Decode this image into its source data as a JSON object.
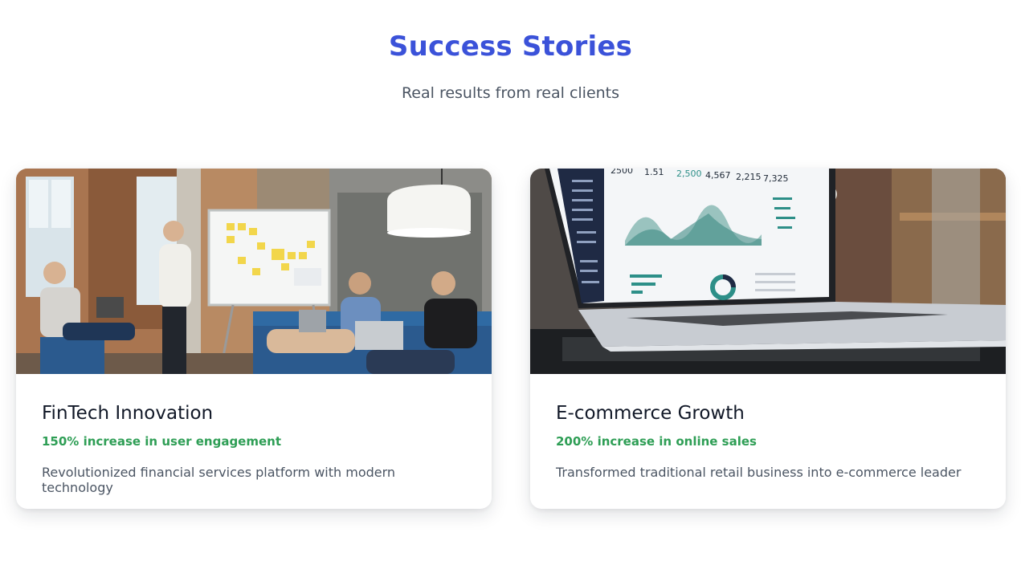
{
  "header": {
    "title": "Success Stories",
    "subtitle": "Real results from real clients"
  },
  "colors": {
    "accent": "#3b52d9",
    "success": "#2e9e55"
  },
  "cards": [
    {
      "image": "team-meeting-photo",
      "title": "FinTech Innovation",
      "metric": "150% increase in user engagement",
      "description": "Revolutionized financial services platform with modern technology"
    },
    {
      "image": "laptop-analytics-dashboard-photo",
      "title": "E-commerce Growth",
      "metric": "200% increase in online sales",
      "description": "Transformed traditional retail business into e-commerce leader"
    }
  ],
  "dashboard_screen": {
    "stats": [
      "2500",
      "1.51",
      "2,500",
      "4,567",
      "2,215",
      "7,325"
    ]
  }
}
